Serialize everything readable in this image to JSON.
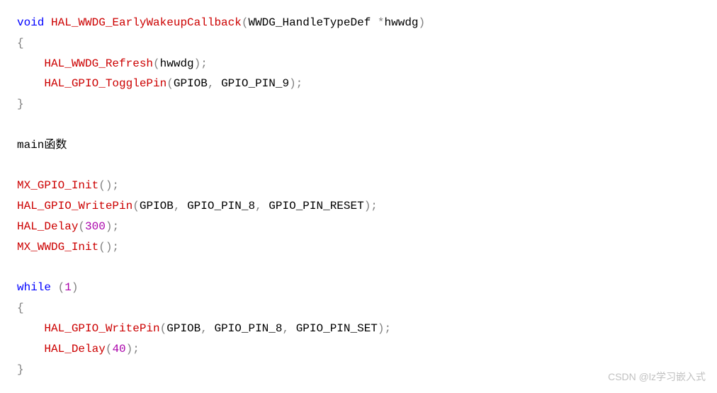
{
  "code": {
    "l1": {
      "kw": "void",
      "fn": "HAL_WWDG_EarlyWakeupCallback",
      "p1": "(",
      "id1": "WWDG_HandleTypeDef ",
      "op": "*",
      "id2": "hwwdg",
      "p2": ")"
    },
    "l2": {
      "p": "{"
    },
    "l3": {
      "fn": "HAL_WWDG_Refresh",
      "p1": "(",
      "id": "hwwdg",
      "p2": ");"
    },
    "l4": {
      "fn": "HAL_GPIO_TogglePin",
      "p1": "(",
      "id1": "GPIOB",
      "c": ", ",
      "id2": "GPIO_PIN_9",
      "p2": ");"
    },
    "l5": {
      "p": "}"
    },
    "l6": {
      "txt": "main函数"
    },
    "l7": {
      "fn": "MX_GPIO_Init",
      "p": "();"
    },
    "l8": {
      "fn": "HAL_GPIO_WritePin",
      "p1": "(",
      "id1": "GPIOB",
      "c1": ", ",
      "id2": "GPIO_PIN_8",
      "c2": ", ",
      "id3": "GPIO_PIN_RESET",
      "p2": ");"
    },
    "l9": {
      "fn": "HAL_Delay",
      "p1": "(",
      "num": "300",
      "p2": ");"
    },
    "l10": {
      "fn": "MX_WWDG_Init",
      "p": "();"
    },
    "l11": {
      "kw": "while",
      "sp": " ",
      "p1": "(",
      "num": "1",
      "p2": ")"
    },
    "l12": {
      "p": "{"
    },
    "l13": {
      "fn": "HAL_GPIO_WritePin",
      "p1": "(",
      "id1": "GPIOB",
      "c1": ", ",
      "id2": "GPIO_PIN_8",
      "c2": ", ",
      "id3": "GPIO_PIN_SET",
      "p2": ");"
    },
    "l14": {
      "fn": "HAL_Delay",
      "p1": "(",
      "num": "40",
      "p2": ");"
    },
    "l15": {
      "p": "}"
    }
  },
  "watermark": "CSDN @lz学习嵌入式"
}
